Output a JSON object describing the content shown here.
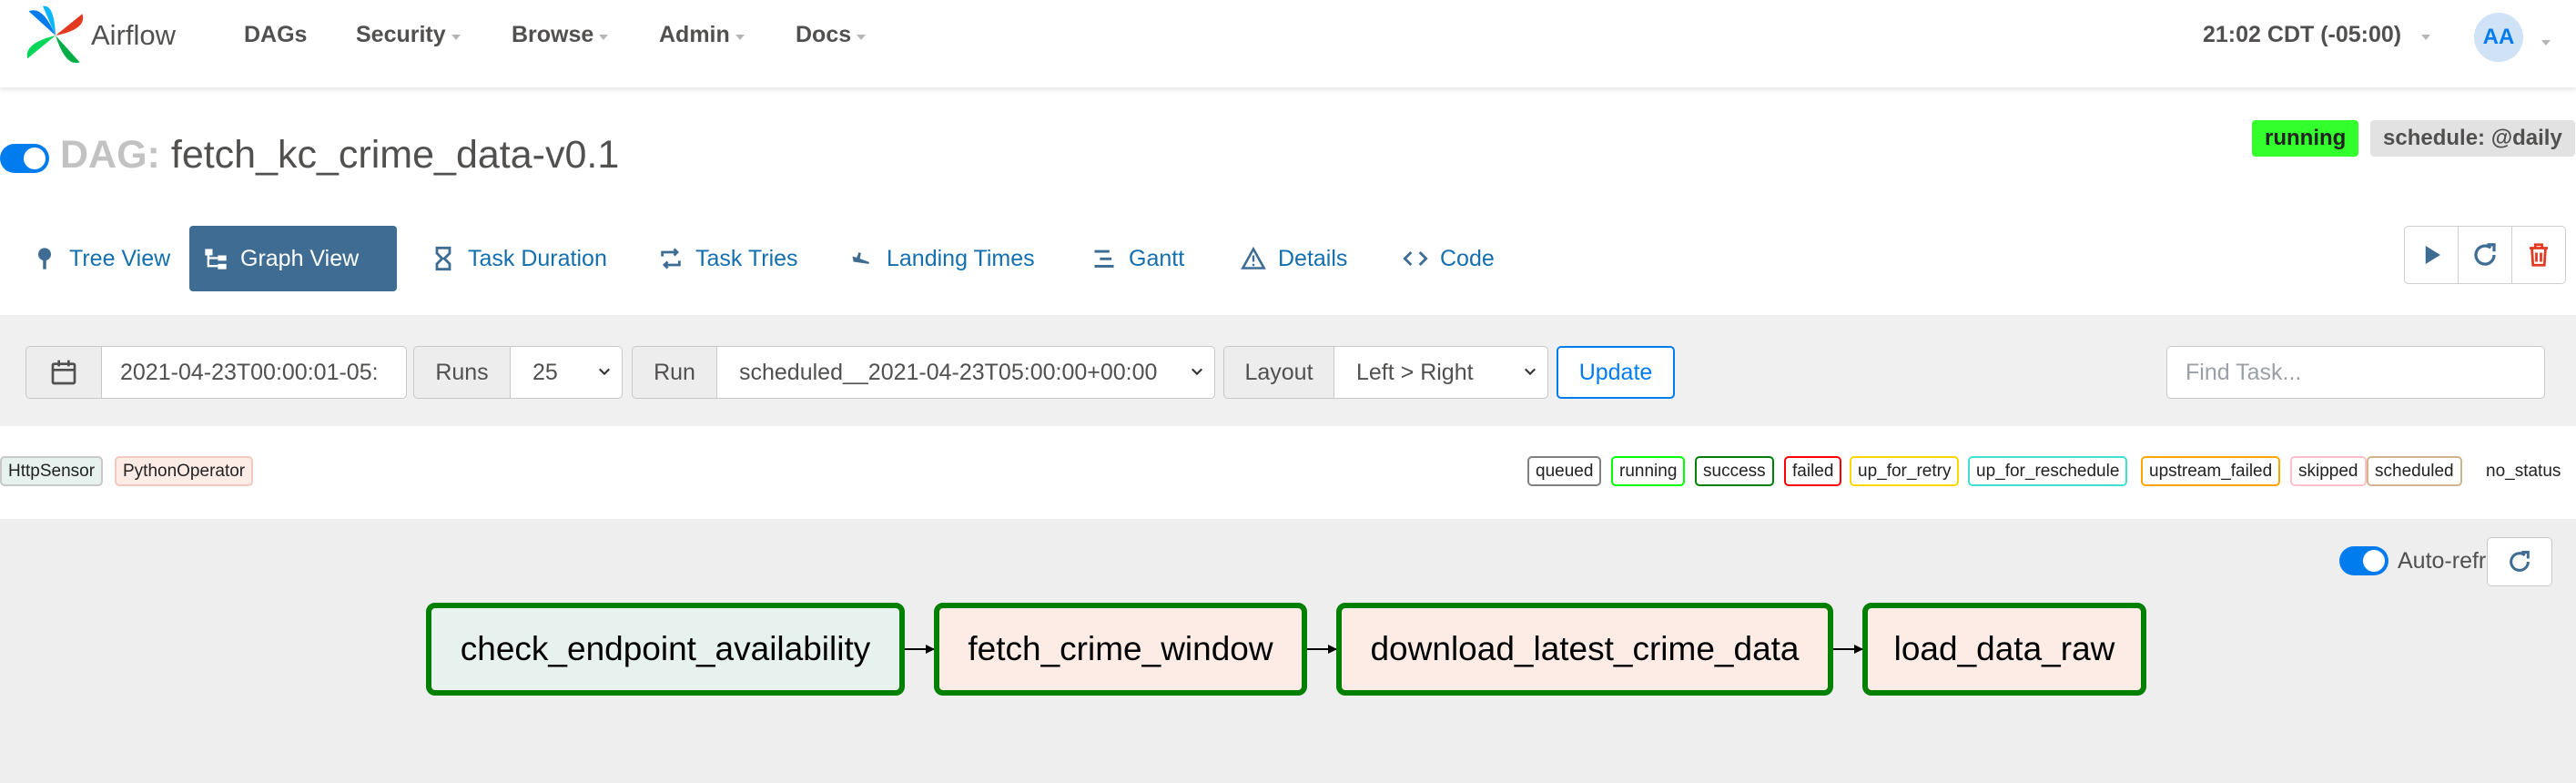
{
  "navbar": {
    "brand": "Airflow",
    "menu": [
      {
        "label": "DAGs",
        "dropdown": false
      },
      {
        "label": "Security",
        "dropdown": true
      },
      {
        "label": "Browse",
        "dropdown": true
      },
      {
        "label": "Admin",
        "dropdown": true
      },
      {
        "label": "Docs",
        "dropdown": true
      }
    ],
    "clock": "21:02 CDT (-05:00)",
    "user_initials": "AA"
  },
  "dag": {
    "prefix": "DAG:",
    "name": "fetch_kc_crime_data-v0.1",
    "paused": false,
    "state_badge": "running",
    "schedule_badge": "schedule: @daily"
  },
  "tabs": [
    {
      "label": "Tree View",
      "icon": "tree-icon",
      "active": false
    },
    {
      "label": "Graph View",
      "icon": "graph-icon",
      "active": true
    },
    {
      "label": "Task Duration",
      "icon": "hourglass-icon",
      "active": false
    },
    {
      "label": "Task Tries",
      "icon": "retry-icon",
      "active": false
    },
    {
      "label": "Landing Times",
      "icon": "plane-landing-icon",
      "active": false
    },
    {
      "label": "Gantt",
      "icon": "gantt-icon",
      "active": false
    },
    {
      "label": "Details",
      "icon": "warning-triangle-icon",
      "active": false
    },
    {
      "label": "Code",
      "icon": "code-icon",
      "active": false
    }
  ],
  "actions": [
    "play-icon",
    "refresh-icon",
    "trash-icon"
  ],
  "controls": {
    "base_date": "2021-04-23T00:00:01-05:",
    "runs_label": "Runs",
    "runs_value": "25",
    "run_label": "Run",
    "run_value": "scheduled__2021-04-23T05:00:00+00:00",
    "layout_label": "Layout",
    "layout_value": "Left > Right",
    "update_label": "Update",
    "find_placeholder": "Find Task..."
  },
  "operators": [
    "HttpSensor",
    "PythonOperator"
  ],
  "states": [
    {
      "label": "queued",
      "color": "#808080"
    },
    {
      "label": "running",
      "color": "#00ff00"
    },
    {
      "label": "success",
      "color": "#008000"
    },
    {
      "label": "failed",
      "color": "#ff0000"
    },
    {
      "label": "up_for_retry",
      "color": "#ffd700"
    },
    {
      "label": "up_for_reschedule",
      "color": "#40e0d0"
    },
    {
      "label": "upstream_failed",
      "color": "#ffa500"
    },
    {
      "label": "skipped",
      "color": "#ffc0cb"
    },
    {
      "label": "scheduled",
      "color": "#d2b48c"
    },
    {
      "label": "no_status",
      "color": ""
    }
  ],
  "graph": {
    "auto_refresh_label": "Auto-refresh",
    "auto_refresh": true,
    "nodes": [
      {
        "label": "check_endpoint_availability",
        "operator": "HttpSensor",
        "state": "success"
      },
      {
        "label": "fetch_crime_window",
        "operator": "PythonOperator",
        "state": "success"
      },
      {
        "label": "download_latest_crime_data",
        "operator": "PythonOperator",
        "state": "success"
      },
      {
        "label": "load_data_raw",
        "operator": "PythonOperator",
        "state": "success"
      }
    ]
  },
  "colors": {
    "accent": "#017cee",
    "active_tab": "#3e6c92",
    "running_badge": "#32ff2b",
    "success_border": "#008000"
  }
}
